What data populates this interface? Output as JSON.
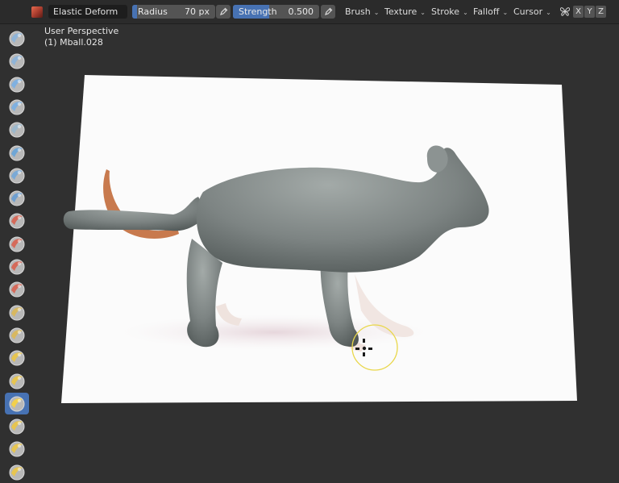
{
  "header": {
    "brush_name": "Elastic Deform",
    "radius": {
      "label": "Radius",
      "value": "70 px",
      "fill_fraction": 0.06
    },
    "strength": {
      "label": "Strength",
      "value": "0.500",
      "fill_fraction": 0.42
    },
    "menus": [
      "Brush",
      "Texture",
      "Stroke",
      "Falloff",
      "Cursor"
    ],
    "axes": [
      "X",
      "Y",
      "Z"
    ]
  },
  "viewport": {
    "view_name": "User Perspective",
    "object_name": "(1) Mball.028"
  },
  "tools": [
    {
      "icon": "draw-brush-icon"
    },
    {
      "icon": "draw-sharp-brush-icon"
    },
    {
      "icon": "clay-brush-icon"
    },
    {
      "icon": "clay-strips-brush-icon"
    },
    {
      "icon": "clay-thumb-brush-icon"
    },
    {
      "icon": "layer-brush-icon"
    },
    {
      "icon": "inflate-brush-icon"
    },
    {
      "icon": "blob-brush-icon"
    },
    {
      "icon": "crease-brush-icon"
    },
    {
      "icon": "smooth-brush-icon"
    },
    {
      "icon": "flatten-brush-icon"
    },
    {
      "icon": "fill-brush-icon"
    },
    {
      "icon": "scrape-brush-icon"
    },
    {
      "icon": "multiplane-scrape-brush-icon"
    },
    {
      "icon": "pinch-brush-icon"
    },
    {
      "icon": "grab-brush-icon"
    },
    {
      "icon": "elastic-deform-brush-icon",
      "active": true
    },
    {
      "icon": "snake-hook-brush-icon"
    },
    {
      "icon": "thumb-brush-icon"
    },
    {
      "icon": "pose-brush-icon"
    }
  ],
  "colors": {
    "accent": "#4772b3",
    "header_bg": "#2b2b2b",
    "viewport_bg": "#303030",
    "cursor_ring": "#e9d74a"
  }
}
